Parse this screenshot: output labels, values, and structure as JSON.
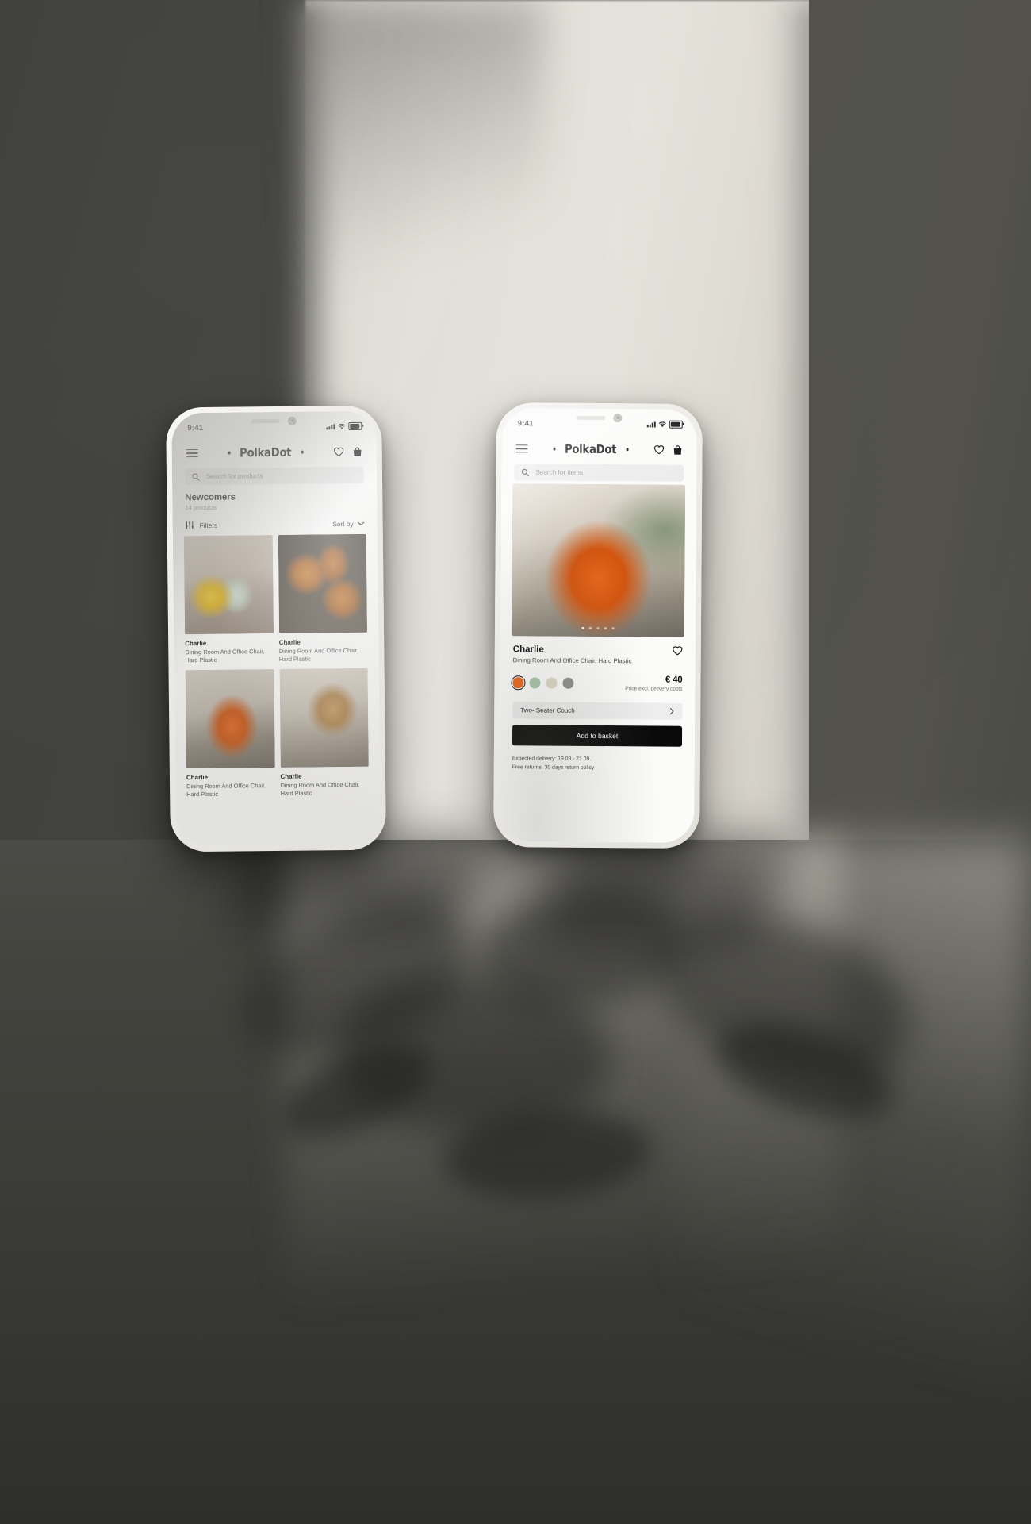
{
  "scene": {
    "description": "Two smartphones floating in front of a concrete wall with daylight band and plant shadows"
  },
  "brand": {
    "name": "PolkaDot",
    "dot_left": "•",
    "dot_right": "•"
  },
  "colors": {
    "accent_orange": "#E8661B",
    "swatch_sage": "#A8C3A8",
    "swatch_sand": "#DCD6C4",
    "swatch_grey": "#8E8E8E",
    "button_black": "#0A0A0A",
    "field_grey": "#ECECEC"
  },
  "phone_left": {
    "status": {
      "time": "9:41",
      "signal": "signal-icon",
      "wifi": "wifi-icon",
      "battery": "battery-icon"
    },
    "appbar": {
      "menu": "hamburger-icon",
      "wishlist": "heart-icon",
      "bag": "shopping-bag-icon"
    },
    "search": {
      "placeholder": "Search for products",
      "icon": "search-icon"
    },
    "section": {
      "title": "Newcomers",
      "count": "14 products"
    },
    "controls": {
      "filters_label": "Filters",
      "filters_icon": "sliders-icon",
      "sort_label": "Sort by",
      "sort_icon": "chevron-down-icon"
    },
    "products": [
      {
        "name": "Charlie",
        "desc": "Dining Room And Office Chair, Hard Plastic",
        "image": "yellow-and-sage-chairs"
      },
      {
        "name": "Charlie",
        "desc": "Dining Room And Office Chair, Hard Plastic",
        "image": "copper-pendant-lamps"
      },
      {
        "name": "Charlie",
        "desc": "Dining Room And Office Chair, Hard Plastic",
        "image": "orange-leather-couch"
      },
      {
        "name": "Charlie",
        "desc": "Dining Room And Office Chair, Hard Plastic",
        "image": "wooden-table-and-chair"
      }
    ]
  },
  "phone_right": {
    "status": {
      "time": "9:41",
      "signal": "signal-icon",
      "wifi": "wifi-icon",
      "battery": "battery-icon"
    },
    "appbar": {
      "menu": "hamburger-icon",
      "wishlist": "heart-icon",
      "bag": "shopping-bag-icon"
    },
    "search": {
      "placeholder": "Search for items",
      "icon": "search-icon"
    },
    "gallery": {
      "image": "orange-leather-couch-hero",
      "slides": 5,
      "active_slide": 1
    },
    "product": {
      "name": "Charlie",
      "desc": "Dining Room And Office Chair, Hard Plastic",
      "favorite_icon": "heart-icon",
      "price": "€ 40",
      "price_note": "Price excl. delivery costs",
      "colors": [
        {
          "name": "orange",
          "hex": "#E8661B",
          "selected": true
        },
        {
          "name": "sage",
          "hex": "#A8C3A8",
          "selected": false
        },
        {
          "name": "sand",
          "hex": "#DCD6C4",
          "selected": false
        },
        {
          "name": "grey",
          "hex": "#8E8E8E",
          "selected": false
        }
      ],
      "variant_label": "Two- Seater Couch",
      "variant_icon": "chevron-right-icon",
      "cta_label": "Add to basket",
      "delivery_note": "Expected delivery: 19.09.- 21.09.",
      "returns_note": "Free returns, 30 days return policy"
    }
  }
}
